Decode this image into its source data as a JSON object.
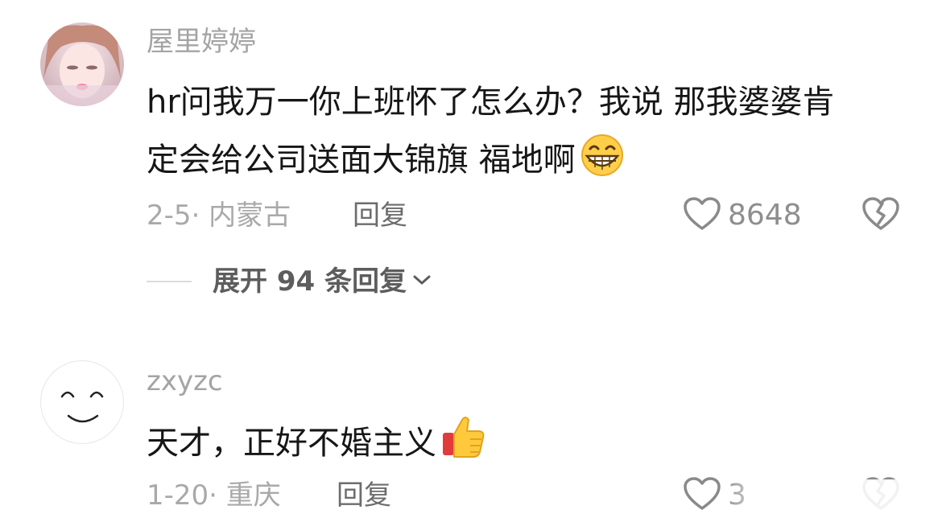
{
  "comments": [
    {
      "username": "屋里婷婷",
      "line1": "hr问我万一你上班怀了怎么办？我说 那我婆婆肯",
      "line2": "定会给公司送面大锦旗 福地啊",
      "emoji": "grinning-face-emoji",
      "date_location": "2-5· 内蒙古",
      "reply_label": "回复",
      "likes": "8648",
      "expand_label": "展开 94 条回复"
    },
    {
      "username": "zxyzc",
      "line1": "天才，正好不婚主义",
      "emoji": "thumbs-up-emoji",
      "date_location": "1-20· 重庆",
      "reply_label": "回复",
      "likes": "3"
    }
  ],
  "icons": {
    "like": "heart-outline-icon",
    "dislike": "broken-heart-icon",
    "expand": "chevron-down-icon"
  },
  "colors": {
    "text": "#161616",
    "muted": "#a4a4a4",
    "icon": "#8a8a8a"
  }
}
